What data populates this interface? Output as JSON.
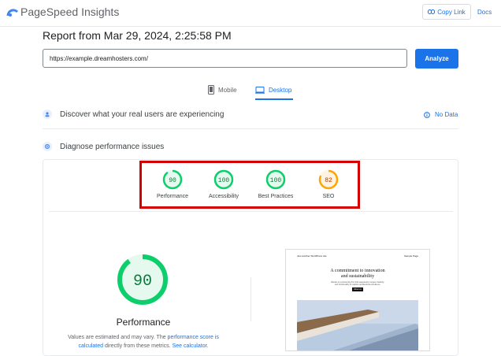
{
  "app": {
    "title": "PageSpeed Insights"
  },
  "header": {
    "copy_link_label": "Copy Link",
    "docs_label": "Docs"
  },
  "report": {
    "title": "Report from Mar 29, 2024, 2:25:58 PM"
  },
  "search": {
    "url_value": "https://example.dreamhosters.com/",
    "analyze_label": "Analyze"
  },
  "tabs": [
    {
      "label": "Mobile",
      "active": false
    },
    {
      "label": "Desktop",
      "active": true
    }
  ],
  "sections": {
    "real_users": "Discover what your real users are experiencing",
    "no_data": "No Data",
    "diagnose": "Diagnose performance issues"
  },
  "scores": [
    {
      "value": "90",
      "label": "Performance",
      "color": "#0cce6b"
    },
    {
      "value": "100",
      "label": "Accessibility",
      "color": "#0cce6b"
    },
    {
      "value": "100",
      "label": "Best Practices",
      "color": "#0cce6b"
    },
    {
      "value": "82",
      "label": "SEO",
      "color": "#ffa400"
    }
  ],
  "main_score": {
    "value": "90",
    "label": "Performance"
  },
  "note": {
    "part1": "Values are estimated and may vary. The ",
    "link1": "performance score is calculated",
    "part2": " directly from these metrics. ",
    "link2": "See calculator."
  },
  "preview": {
    "site_name": "Just another WordPress site",
    "nav": "Sample Page",
    "headline1": "A commitment to innovation",
    "headline2": "and sustainability",
    "body": "Études is a pioneering firm that seamlessly merges creativity and functionality to redefine architectural excellence.",
    "button": "About us"
  },
  "colors": {
    "accent": "#1a73e8",
    "good": "#0cce6b",
    "average": "#ffa400",
    "highlight": "#d50000"
  }
}
